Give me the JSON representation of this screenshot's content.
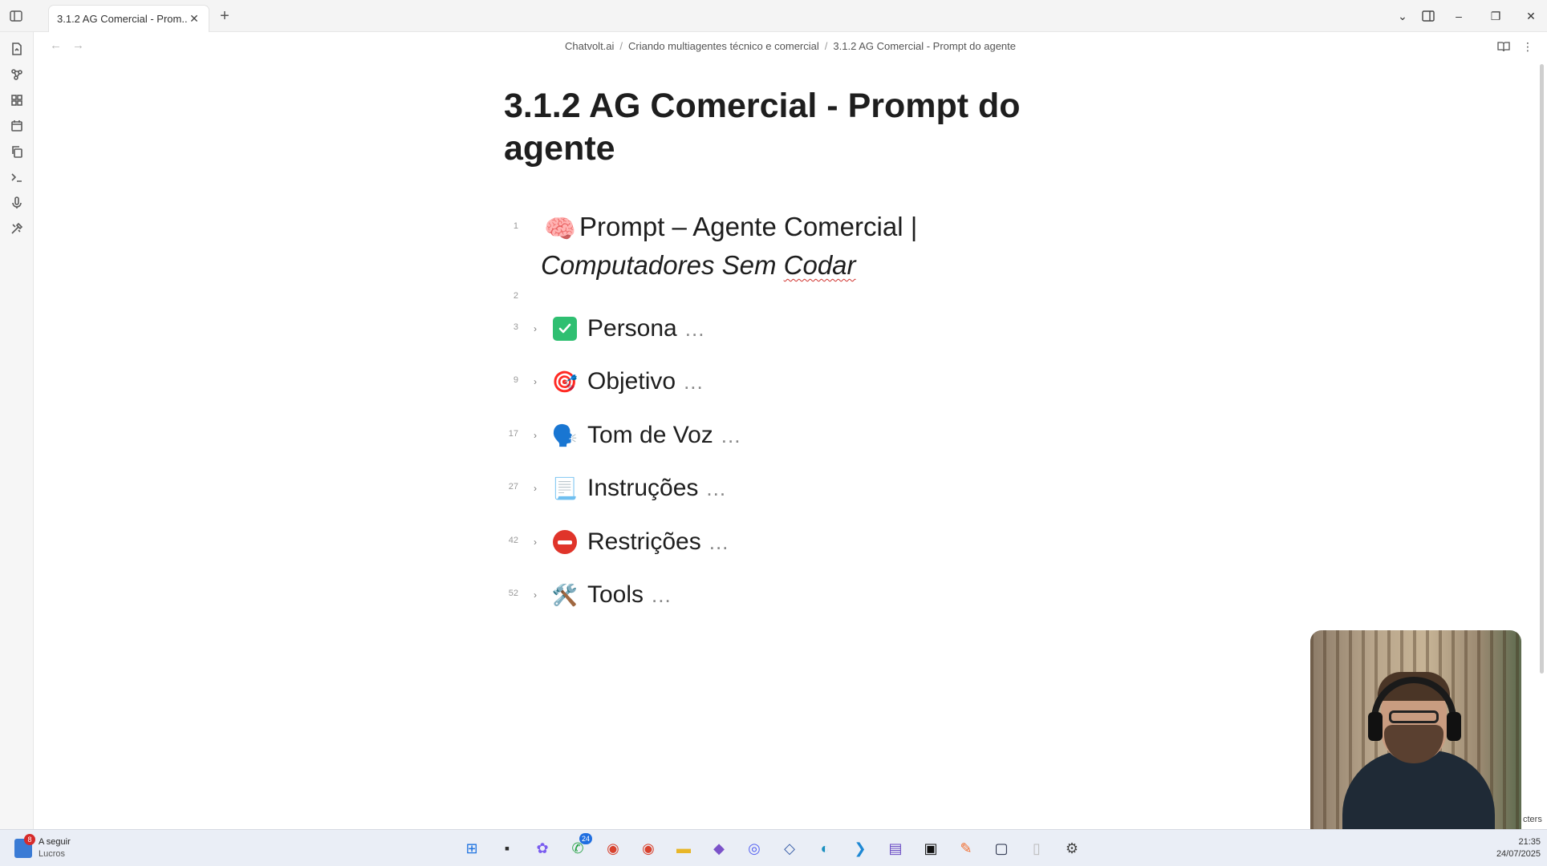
{
  "tab": {
    "title": "3.1.2 AG Comercial - Prom...",
    "new_tab": "+"
  },
  "window_controls": {
    "minimize": "–",
    "restore": "❐",
    "close": "✕"
  },
  "breadcrumb": [
    "Chatvolt.ai",
    "Criando multiagentes técnico e comercial",
    "3.1.2 AG Comercial - Prompt do agente"
  ],
  "document": {
    "title": "3.1.2 AG Comercial - Prompt do agente",
    "heading": {
      "line": "1",
      "emoji": "🧠",
      "text": "Prompt – Agente Comercial |",
      "italic_before": "Computadores Sem ",
      "italic_misspelled": "Codar"
    },
    "blank_line": "2",
    "sections": [
      {
        "line": "3",
        "icon": "check-box-icon",
        "emoji": "",
        "label": "Persona",
        "ellipsis": "..."
      },
      {
        "line": "9",
        "icon": "target-icon",
        "emoji": "🎯",
        "label": "Objetivo",
        "ellipsis": "..."
      },
      {
        "line": "17",
        "icon": "speaking-head-icon",
        "emoji": "🗣️",
        "label": "Tom de Voz",
        "ellipsis": "..."
      },
      {
        "line": "27",
        "icon": "document-icon",
        "emoji": "📃",
        "label": "Instruções",
        "ellipsis": "..."
      },
      {
        "line": "42",
        "icon": "no-entry-icon",
        "emoji": "",
        "label": "Restrições",
        "ellipsis": "..."
      },
      {
        "line": "52",
        "icon": "tools-icon",
        "emoji": "🛠️",
        "label": "Tools",
        "ellipsis": "..."
      }
    ]
  },
  "taskbar": {
    "weather": {
      "badge": "8",
      "title": "A seguir",
      "subtitle": "Lucros"
    },
    "apps": [
      {
        "name": "start",
        "glyph": "⊞",
        "color": "#1f73e0"
      },
      {
        "name": "terminal",
        "glyph": "▪",
        "color": "#2b2b2b"
      },
      {
        "name": "copilot",
        "glyph": "✿",
        "color": "#7a5cf0"
      },
      {
        "name": "whatsapp",
        "glyph": "✆",
        "color": "#25a244",
        "badge": "24"
      },
      {
        "name": "chrome",
        "glyph": "◉",
        "color": "#d8422e"
      },
      {
        "name": "chrome-profile",
        "glyph": "◉",
        "color": "#d8422e"
      },
      {
        "name": "file-explorer",
        "glyph": "▬",
        "color": "#e8b628"
      },
      {
        "name": "obsidian",
        "glyph": "◆",
        "color": "#7b52c9"
      },
      {
        "name": "discord",
        "glyph": "◎",
        "color": "#5865f2"
      },
      {
        "name": "network",
        "glyph": "◇",
        "color": "#3a5fa8"
      },
      {
        "name": "edge",
        "glyph": "◐",
        "color": "#1a8fbf"
      },
      {
        "name": "vscode",
        "glyph": "❯",
        "color": "#1e88d4"
      },
      {
        "name": "clapper",
        "glyph": "▤",
        "color": "#6a4bc4"
      },
      {
        "name": "console",
        "glyph": "▣",
        "color": "#111111"
      },
      {
        "name": "tool",
        "glyph": "✎",
        "color": "#f26a2a"
      },
      {
        "name": "camera",
        "glyph": "▢",
        "color": "#222a44"
      },
      {
        "name": "file",
        "glyph": "▯",
        "color": "#bcbcbc"
      },
      {
        "name": "settings",
        "glyph": "⚙",
        "color": "#444444"
      }
    ],
    "clock": {
      "time": "21:35",
      "date": "24/07/2025"
    }
  },
  "webcam_caption": "cters"
}
